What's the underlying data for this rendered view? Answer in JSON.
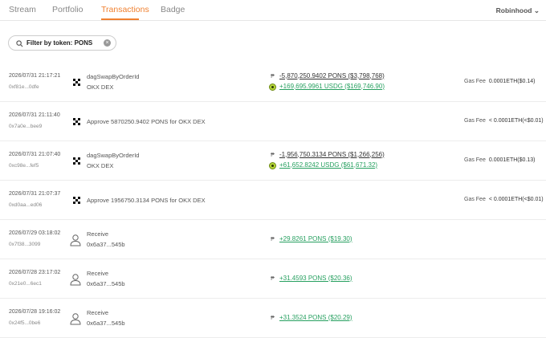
{
  "nav": {
    "tabs": [
      "Stream",
      "Portfolio",
      "Transactions",
      "Badge"
    ],
    "account": "Robinhood"
  },
  "filter": {
    "text": "Filter by token: PONS",
    "clear_icon": "close-circle-icon"
  },
  "gas_label": "Gas Fee",
  "colors": {
    "accent": "#f08030",
    "positive": "#27a060"
  },
  "rows": [
    {
      "time": "2026/07/31 21:17:21",
      "hash": "0xf81e...0dfe",
      "icon": "okx-icon",
      "action": "dagSwapByOrderId",
      "sub": "OKX DEX",
      "amounts": [
        {
          "text": "-5,870,250.9402 PONS ($3,798,768)",
          "icon": "pons-token-icon"
        },
        {
          "text": "+169,695.9961 USDG ($169,746.90)",
          "icon": "usdg-token-icon"
        }
      ],
      "gas": "0.0001ETH($0.14)"
    },
    {
      "time": "2026/07/31 21:11:40",
      "hash": "0x7a0e...bee9",
      "icon": "okx-icon",
      "action": "Approve 5870250.9402 PONS for OKX DEX",
      "gas": "< 0.0001ETH(<$0.01)"
    },
    {
      "time": "2026/07/31 21:07:40",
      "hash": "0xc98e...fef5",
      "icon": "okx-icon",
      "action": "dagSwapByOrderId",
      "sub": "OKX DEX",
      "amounts": [
        {
          "text": "-1,956,750.3134 PONS ($1,266,256)",
          "icon": "pons-token-icon"
        },
        {
          "text": "+61,652.8242 USDG ($61,671.32)",
          "icon": "usdg-token-icon"
        }
      ],
      "gas": "0.0001ETH($0.13)"
    },
    {
      "time": "2026/07/31 21:07:37",
      "hash": "0xd0aa...ed06",
      "icon": "okx-icon",
      "action": "Approve 1956750.3134 PONS for OKX DEX",
      "gas": "< 0.0001ETH(<$0.01)"
    },
    {
      "time": "2026/07/29 03:18:02",
      "hash": "0x7f38...3099",
      "icon": "user-icon",
      "action": "Receive",
      "sub": "0x6a37...545b",
      "amounts": [
        {
          "text": "+29.8261 PONS ($19.30)",
          "icon": "pons-token-icon"
        }
      ]
    },
    {
      "time": "2026/07/28 23:17:02",
      "hash": "0x21e0...6ec1",
      "icon": "user-icon",
      "action": "Receive",
      "sub": "0x6a37...545b",
      "amounts": [
        {
          "text": "+31.4593 PONS ($20.36)",
          "icon": "pons-token-icon"
        }
      ]
    },
    {
      "time": "2026/07/28 19:16:02",
      "hash": "0x24f5...0be6",
      "icon": "user-icon",
      "action": "Receive",
      "sub": "0x6a37...545b",
      "amounts": [
        {
          "text": "+31.3524 PONS ($20.29)",
          "icon": "pons-token-icon"
        }
      ]
    }
  ]
}
